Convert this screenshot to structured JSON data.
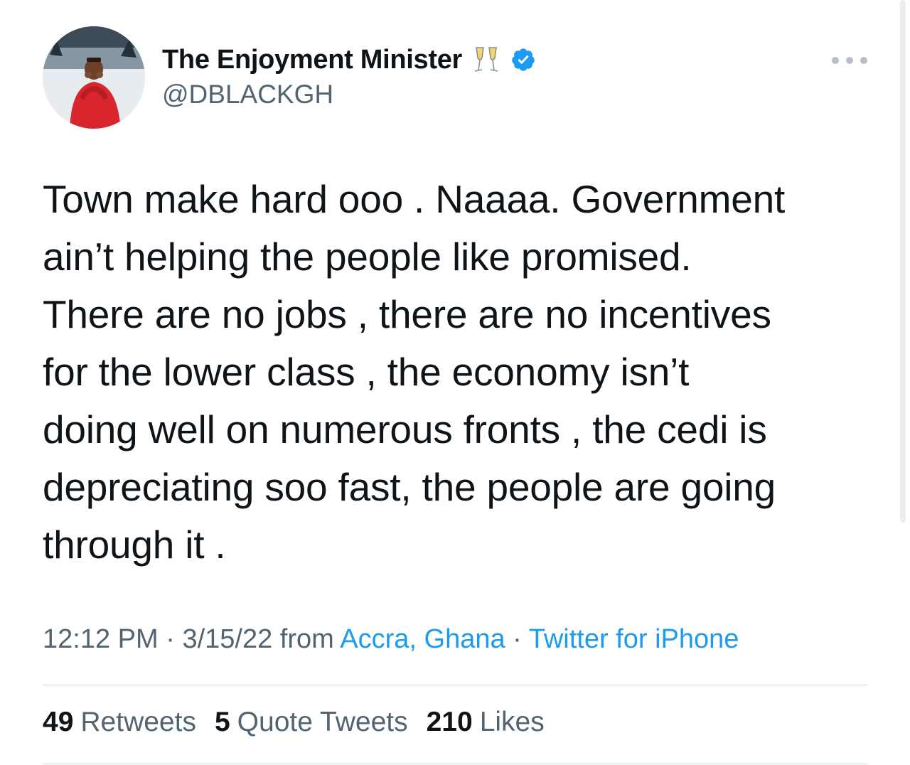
{
  "tweet": {
    "display_name": "The Enjoyment Minister",
    "emoji_icon": "clinking-glasses-icon",
    "verified_icon": "verified-badge-icon",
    "handle": "@DBLACKGH",
    "text": "Town make hard ooo . Naaaa. Government\nain’t helping the people like promised.\nThere are no jobs , there are no incentives\nfor the lower class , the economy isn’t\ndoing well on numerous fronts , the cedi is\ndepreciating soo fast, the people are going\nthrough it .",
    "time": "12:12 PM",
    "separator": "·",
    "date": "3/15/22",
    "from_label": "from",
    "location": "Accra, Ghana",
    "source": "Twitter for iPhone",
    "stats": {
      "retweets_count": "49",
      "retweets_label": "Retweets",
      "quotes_count": "5",
      "quotes_label": "Quote Tweets",
      "likes_count": "210",
      "likes_label": "Likes"
    }
  },
  "colors": {
    "text": "#0f1419",
    "secondary": "#536471",
    "link": "#1d9bf0",
    "divider": "#cfd9de"
  }
}
